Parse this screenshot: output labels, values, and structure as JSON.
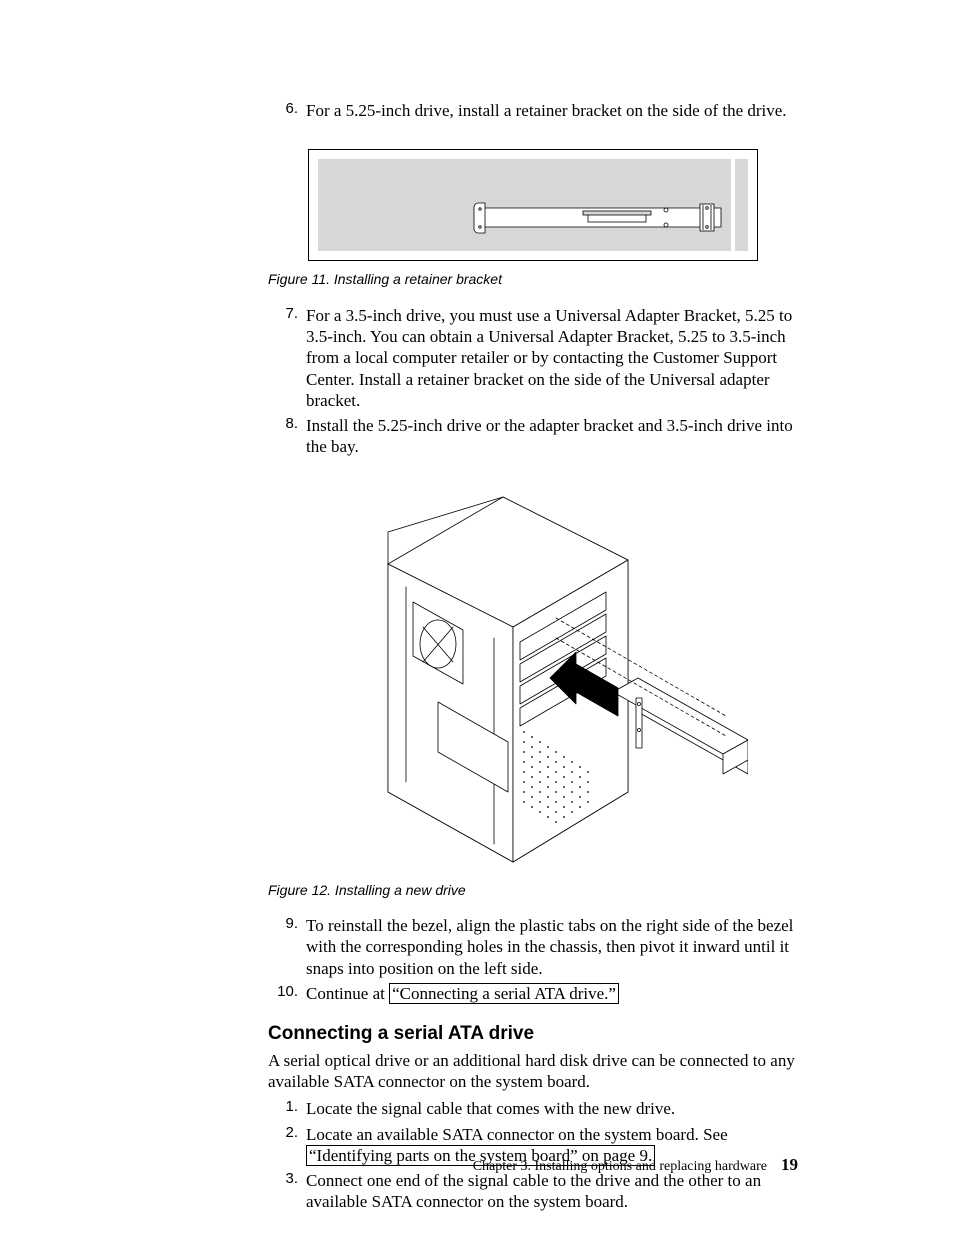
{
  "list": {
    "item6": {
      "n": "6.",
      "text": "For a 5.25-inch drive, install a retainer bracket on the side of the drive."
    },
    "item7": {
      "n": "7.",
      "text": "For a 3.5-inch drive, you must use a Universal Adapter Bracket, 5.25 to 3.5-inch. You can obtain a Universal Adapter Bracket, 5.25 to 3.5-inch from a local computer retailer or by contacting the Customer Support Center. Install a retainer bracket on the side of the Universal adapter bracket."
    },
    "item8": {
      "n": "8.",
      "text": "Install the 5.25-inch drive or the adapter bracket and 3.5-inch drive into the bay."
    },
    "item9": {
      "n": "9.",
      "text": "To reinstall the bezel, align the plastic tabs on the right side of the bezel with the corresponding holes in the chassis, then pivot it inward until it snaps into position on the left side."
    },
    "item10": {
      "n": "10.",
      "pre": "Continue at ",
      "xref": "“Connecting a serial ATA drive.”"
    }
  },
  "fig11": "Figure 11. Installing a retainer bracket",
  "fig12": "Figure 12. Installing a new drive",
  "sectionTitle": "Connecting a serial ATA drive",
  "sectionLead": "A serial optical drive or an additional hard disk drive can be connected to any available SATA connector on the system board.",
  "sub": {
    "item1": {
      "n": "1.",
      "text": "Locate the signal cable that comes with the new drive."
    },
    "item2": {
      "n": "2.",
      "pre": "Locate an available SATA connector on the system board. See ",
      "xref": "“Identifying parts on the system board” on page 9."
    },
    "item3": {
      "n": "3.",
      "text": "Connect one end of the signal cable to the drive and the other to an available SATA connector on the system board."
    }
  },
  "footer": {
    "chapter": "Chapter 3. Installing options and replacing hardware",
    "page": "19"
  }
}
